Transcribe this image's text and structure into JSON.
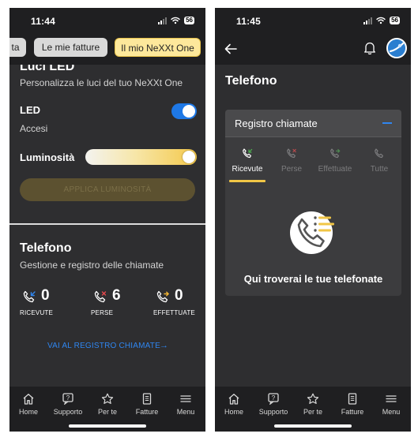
{
  "left": {
    "status": {
      "time": "11:44",
      "battery": "56"
    },
    "tabs": [
      {
        "label": "ta"
      },
      {
        "label": "Le mie fatture"
      },
      {
        "label": "Il mio NeXXt One"
      }
    ],
    "led_section": {
      "title": "Luci LED",
      "subtitle": "Personalizza le luci del tuo NeXXt One",
      "led_label": "LED",
      "led_state": "Accesi",
      "led_on": true,
      "brightness_label": "Luminosità",
      "brightness_level": 1.0,
      "apply_button": "APPLICA LUMINOSITÀ"
    },
    "phone_section": {
      "title": "Telefono",
      "subtitle": "Gestione e registro delle chiamate",
      "stats": [
        {
          "value": "0",
          "label": "RICEVUTE",
          "icon": "phone-incoming-icon",
          "accent": "#2f86f0"
        },
        {
          "value": "6",
          "label": "PERSE",
          "icon": "phone-missed-icon",
          "accent": "#e5484d"
        },
        {
          "value": "0",
          "label": "EFFETTUATE",
          "icon": "phone-outgoing-icon",
          "accent": "#f1b434"
        }
      ],
      "link": "VAI AL REGISTRO CHIAMATE",
      "link_arrow": "→"
    }
  },
  "right": {
    "status": {
      "time": "11:45",
      "battery": "56"
    },
    "page_title": "Telefono",
    "card": {
      "title": "Registro chiamate",
      "tabs": [
        {
          "label": "Ricevute",
          "active": true
        },
        {
          "label": "Perse",
          "active": false
        },
        {
          "label": "Effettuate",
          "active": false
        },
        {
          "label": "Tutte",
          "active": false
        }
      ],
      "empty_text": "Qui troverai le tue telefonate"
    }
  },
  "nav": [
    {
      "label": "Home",
      "icon": "home-icon"
    },
    {
      "label": "Supporto",
      "icon": "support-icon"
    },
    {
      "label": "Per te",
      "icon": "star-icon"
    },
    {
      "label": "Fatture",
      "icon": "invoice-icon"
    },
    {
      "label": "Menu",
      "icon": "menu-icon"
    }
  ],
  "colors": {
    "accent_blue": "#2f86f0",
    "accent_yellow": "#f1c646",
    "background": "#2e2e30",
    "bar": "#1f1f21"
  }
}
